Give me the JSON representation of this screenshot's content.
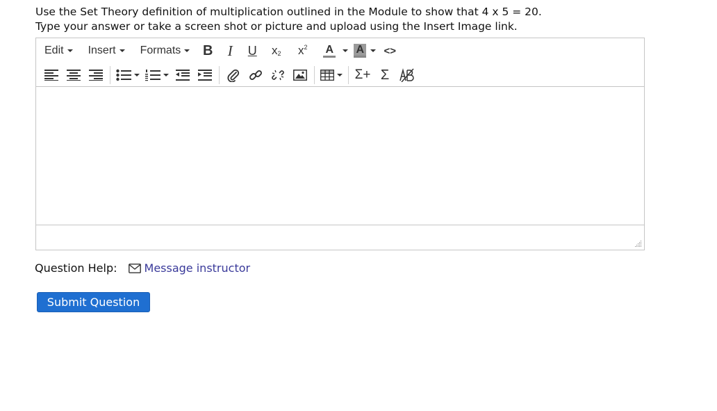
{
  "question": {
    "line1": "Use the Set Theory definition of multiplication outlined in the Module to show that 4 x 5 = 20.",
    "line2": "Type your answer or take a screen shot or picture and upload using the Insert Image link."
  },
  "editor": {
    "menus": {
      "edit": "Edit",
      "insert": "Insert",
      "formats": "Formats"
    },
    "buttons": {
      "bold": "B",
      "italic": "I",
      "underline": "U",
      "subscript": "x",
      "subscript_mark": "2",
      "superscript": "x",
      "superscript_mark": "2",
      "text_color": "A",
      "background_color": "A",
      "code": "<>",
      "sigma_plus": "Σ+",
      "sigma": "Σ"
    },
    "content": ""
  },
  "help": {
    "label": "Question Help:",
    "link": "Message instructor"
  },
  "submit": {
    "label": "Submit Question"
  },
  "colors": {
    "submit_bg": "#1f6fd1",
    "link": "#3a3a9a",
    "border": "#c5c5c5"
  }
}
